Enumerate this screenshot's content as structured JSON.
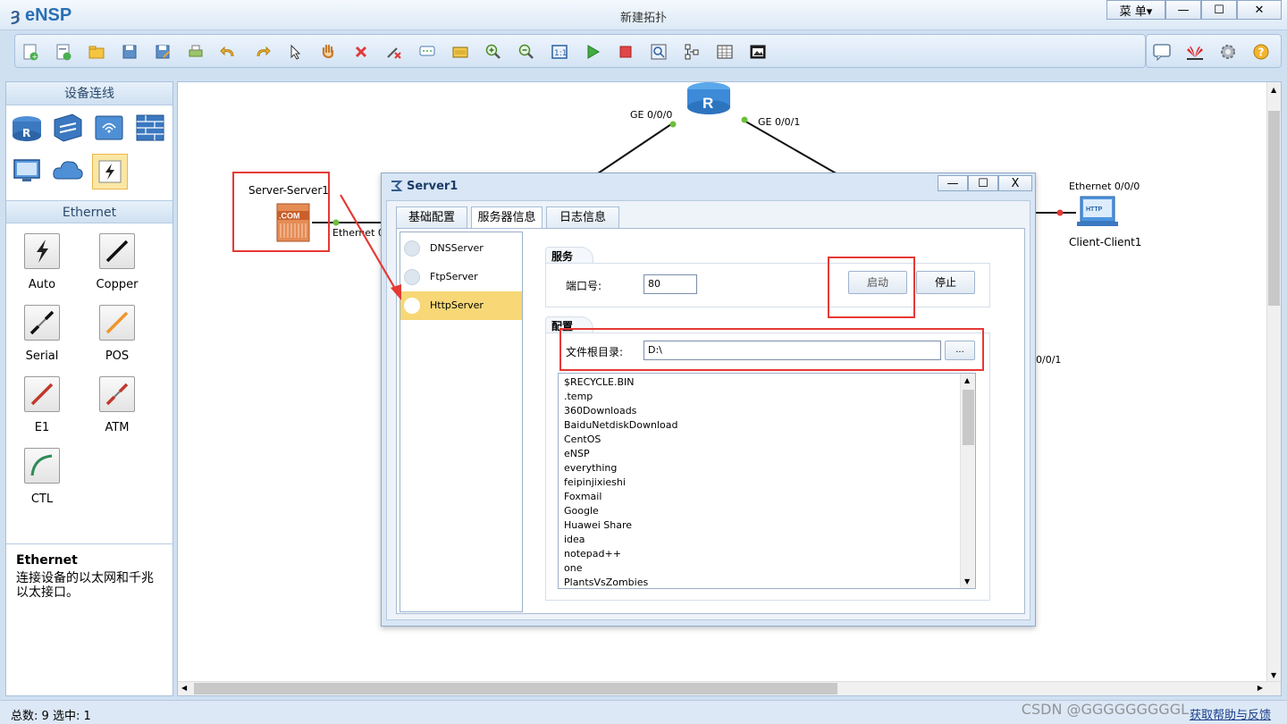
{
  "app": {
    "logo": "eNSP",
    "window_title": "新建拓扑",
    "menu_label": "菜 单▾"
  },
  "window_buttons": {
    "minimize": "—",
    "maximize": "☐",
    "close": "✕"
  },
  "toolbar": {
    "icons": [
      "new-topology-icon",
      "new-example-icon",
      "open-icon",
      "save-icon",
      "save-as-icon",
      "print-icon",
      "undo-icon",
      "redo-icon",
      "select-icon",
      "pan-icon",
      "delete-icon",
      "delete-link-icon",
      "text-icon",
      "palette-icon",
      "zoom-in-icon",
      "zoom-out-icon",
      "fit-icon",
      "start-icon",
      "stop-icon",
      "capture-icon",
      "topology-icon",
      "grid-icon",
      "snapshot-icon"
    ],
    "right_icons": [
      "chat-icon",
      "huawei-logo-icon",
      "settings-icon",
      "help-icon"
    ]
  },
  "left_panel": {
    "device_header": "设备连线",
    "device_icons": [
      "router-icon",
      "switch-icon",
      "wireless-icon",
      "firewall-icon",
      "pc-icon",
      "cloud-icon",
      "connector-icon"
    ],
    "ethernet_header": "Ethernet",
    "cables": [
      {
        "name": "Auto",
        "color": "#222222"
      },
      {
        "name": "Copper",
        "color": "#111111"
      },
      {
        "name": "Serial",
        "color": "#111111"
      },
      {
        "name": "POS",
        "color": "#f0952b"
      },
      {
        "name": "E1",
        "color": "#c0392b"
      },
      {
        "name": "ATM",
        "color": "#c0392b"
      },
      {
        "name": "CTL",
        "color": "#2e8b57"
      }
    ],
    "description_title": "Ethernet",
    "description_text": "连接设备的以太网和千兆以太接口。"
  },
  "canvas": {
    "router_label": "R",
    "labels": {
      "ge000": "GE 0/0/0",
      "ge001": "GE 0/0/1",
      "server_name": "Server-Server1",
      "server_port": "Ethernet 0/",
      "client_port": "Ethernet 0/0/0",
      "client_name": "Client-Client1",
      "partial_port": "0/0/1",
      "server_icon_text": ".COM",
      "client_icon_text": "HTTP"
    }
  },
  "dialog": {
    "title": "Server1",
    "buttons": {
      "minimize": "—",
      "maximize": "☐",
      "close": "X"
    },
    "tabs": [
      "基础配置",
      "服务器信息",
      "日志信息"
    ],
    "active_tab": "服务器信息",
    "servers": [
      "DNSServer",
      "FtpServer",
      "HttpServer"
    ],
    "selected_server": "HttpServer",
    "service_group": "服务",
    "port_label": "端口号:",
    "port_value": "80",
    "start_label": "启动",
    "stop_label": "停止",
    "config_group": "配置",
    "root_label": "文件根目录:",
    "root_value": "D:\\",
    "browse_label": "...",
    "files": [
      "$RECYCLE.BIN",
      ".temp",
      "360Downloads",
      "BaiduNetdiskDownload",
      "CentOS",
      "eNSP",
      "everything",
      "feipinjixieshi",
      "Foxmail",
      "Google",
      "Huawei Share",
      "idea",
      "notepad++",
      "one",
      "PlantsVsZombies"
    ]
  },
  "statusbar": {
    "total_label": "总数:",
    "total_value": "9",
    "selected_label": "选中:",
    "selected_value": "1",
    "help_link": "获取帮助与反馈",
    "watermark": "CSDN @GGGGGGGGGL"
  },
  "colors": {
    "annotation_red": "#e53935",
    "selected_item": "#f7d776",
    "link_dot_green": "#6dbf3a",
    "link_dot_red": "#e53935"
  }
}
